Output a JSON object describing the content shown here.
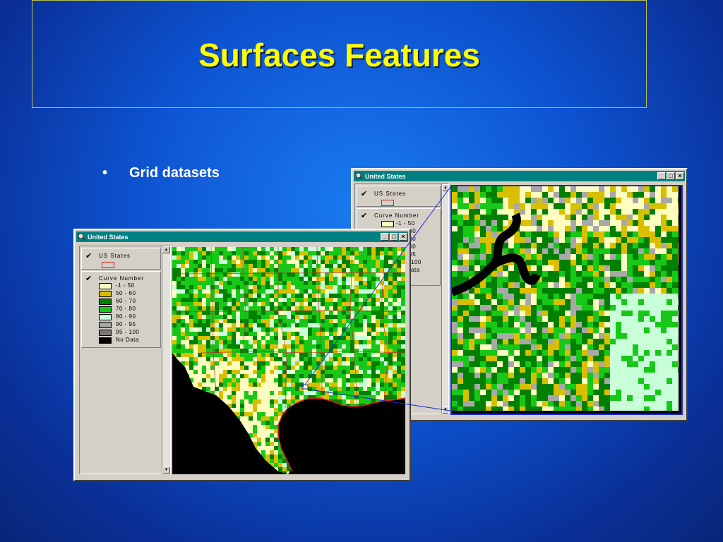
{
  "slide": {
    "title": "Surfaces Features",
    "bullet": "•",
    "bullet_text": "Grid datasets"
  },
  "window": {
    "title": "United States",
    "minimize": "_",
    "maximize": "□",
    "close": "×"
  },
  "toc": {
    "layers": [
      {
        "name": "US States",
        "checked": "✔"
      },
      {
        "name": "Curve Number",
        "checked": "✔"
      }
    ],
    "classes": [
      {
        "label": "-1 - 50",
        "color": "#fffcc0"
      },
      {
        "label": "50 - 60",
        "color": "#d8c000"
      },
      {
        "label": "60 - 70",
        "color": "#008000"
      },
      {
        "label": "70 - 80",
        "color": "#18c818"
      },
      {
        "label": "80 - 90",
        "color": "#c8ffd8"
      },
      {
        "label": "90 - 95",
        "color": "#a8a8a8"
      },
      {
        "label": "95 - 100",
        "color": "#787878"
      },
      {
        "label": "No Data",
        "color": "#000000"
      }
    ]
  },
  "back_window_partial_labels": [
    "-1 - 50",
    "i0",
    "i0",
    "i0",
    "i5",
    "100",
    "ata"
  ],
  "icons": {
    "window_icon": "magnifier-globe-icon",
    "check": "checkmark-icon",
    "scroll_up": "▲",
    "scroll_down": "▼"
  },
  "colors": {
    "titlebar": "#008080",
    "title_text": "#ffff00",
    "state_outline": "#c62828",
    "zoom_line": "#1a2bd6"
  }
}
